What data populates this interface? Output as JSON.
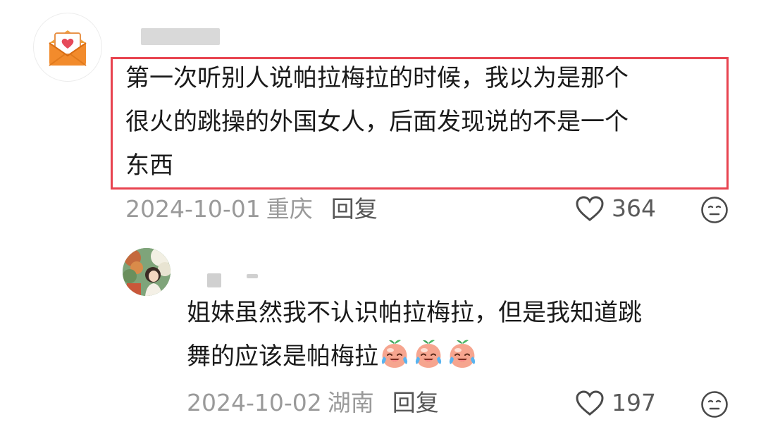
{
  "main_comment": {
    "avatar_icon": "envelope-heart-icon",
    "text_line1": "第一次听别人说帕拉梅拉的时候，我以为是那个",
    "text_line2": "很火的跳操的外国女人，后面发现说的不是一个",
    "text_line3": "东西",
    "date": "2024-10-01",
    "location": "重庆",
    "reply_label": "回复",
    "like_count": "364",
    "highlight_color": "#e8434f"
  },
  "reply_comment": {
    "text_line1": "姐妹虽然我不认识帕拉梅拉，但是我知道跳",
    "text_line2": "舞的应该是帕梅拉",
    "emoji_icon": "crying-laughing-peach-emoji",
    "date": "2024-10-02",
    "location": "湖南",
    "reply_label": "回复",
    "like_count": "197"
  }
}
